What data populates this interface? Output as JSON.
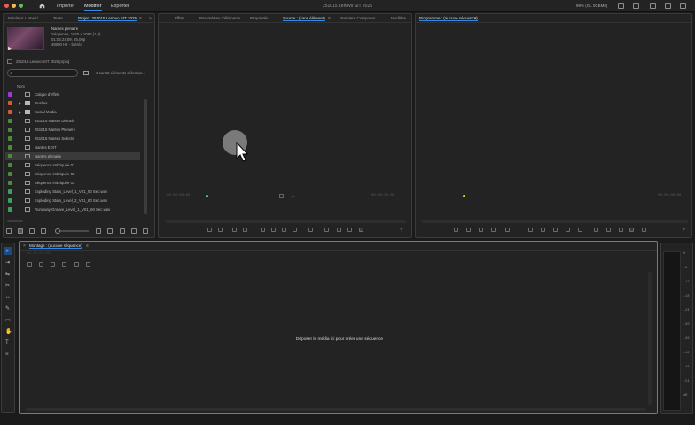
{
  "titlebar": {
    "menu": [
      "Importer",
      "Modifier",
      "Exporter"
    ],
    "active_menu": "Modifier",
    "app_title": "251015 Lenovo SIT 2025",
    "zoom": "99% (GL 0CBM8)"
  },
  "project_panel": {
    "tabs": [
      "Moniteur Lumetri",
      "Texte",
      "Projet : 251015 Lenovo SIT 2025"
    ],
    "active_tab": "Projet : 251015 Lenovo SIT 2025",
    "clip_info": [
      "Nantes plenaire",
      "Séquence, 1920 x 1080 (1,0)",
      "01:05:24:09, 25,00p",
      "48000 Hz - Stéréo"
    ],
    "project_file": "251015 Lenovo SIT 2025.prproj",
    "search": {
      "value": "",
      "placeholder": ""
    },
    "items_count": "1 sur 15 éléments sélection...",
    "column_header": "Nom",
    "items": [
      {
        "label": "Calque d'effets",
        "color": "#9d3bd6",
        "expandable": false,
        "type": "effect"
      },
      {
        "label": "Rushes",
        "color": "#d55a2c",
        "expandable": true,
        "type": "folder"
      },
      {
        "label": "Social Media",
        "color": "#d55a2c",
        "expandable": true,
        "type": "folder"
      },
      {
        "label": "251015 Nantes Dérush",
        "color": "#4a8a3a",
        "expandable": false,
        "type": "sequence"
      },
      {
        "label": "251015 Nantes Plenière",
        "color": "#4a8a3a",
        "expandable": false,
        "type": "sequence"
      },
      {
        "label": "251015 Nantes Selects",
        "color": "#4a8a3a",
        "expandable": false,
        "type": "sequence"
      },
      {
        "label": "Nantes EDIT",
        "color": "#4a8a3a",
        "expandable": false,
        "type": "sequence"
      },
      {
        "label": "Nantes plenaire",
        "color": "#4a8a3a",
        "expandable": false,
        "type": "sequence",
        "selected": true
      },
      {
        "label": "Séquence imbriquée 01",
        "color": "#4a8a3a",
        "expandable": false,
        "type": "sequence"
      },
      {
        "label": "Séquence imbriquée 02",
        "color": "#4a8a3a",
        "expandable": false,
        "type": "sequence"
      },
      {
        "label": "Séquence imbriquée 03",
        "color": "#4a8a3a",
        "expandable": false,
        "type": "sequence"
      },
      {
        "label": "Exploding Stars_Level_1_V01_90 Sec.wav",
        "color": "#3aa060",
        "expandable": false,
        "type": "audio"
      },
      {
        "label": "Exploding Stars_Level_2_V01_60 Sec.wav",
        "color": "#3aa060",
        "expandable": false,
        "type": "audio"
      },
      {
        "label": "Runaway Groove_Level_1_V01_60 Sec.wav",
        "color": "#3aa060",
        "expandable": false,
        "type": "audio"
      }
    ]
  },
  "source_panel": {
    "tabs": [
      "Effets",
      "Paramètres d'éléments",
      "Propriétés",
      "Source : (sans élément)",
      "Premiere Composer",
      "Modèles"
    ],
    "active_tab": "Source : (sans élément)",
    "timecode_in": "00:00:00:00",
    "timecode_out": "00:00:00:00"
  },
  "program_panel": {
    "title": "Programme : (aucune séquence)",
    "timecode_out": "00:00:00:00"
  },
  "timeline_panel": {
    "title": "Montage : (aucune séquence)",
    "timecode": "00:00:00:00",
    "drop_message": "Déposer le média ici pour créer une séquence"
  },
  "audio_meter": {
    "labels": [
      "0",
      "-6",
      "-12",
      "-18",
      "-24",
      "-30",
      "-36",
      "-42",
      "-48",
      "-54",
      "dB"
    ]
  },
  "tools": [
    "selection-tool",
    "track-select-tool",
    "ripple-edit-tool",
    "razor-tool",
    "slip-tool",
    "pen-tool",
    "rectangle-tool",
    "hand-tool",
    "type-tool",
    "caption-tool"
  ]
}
